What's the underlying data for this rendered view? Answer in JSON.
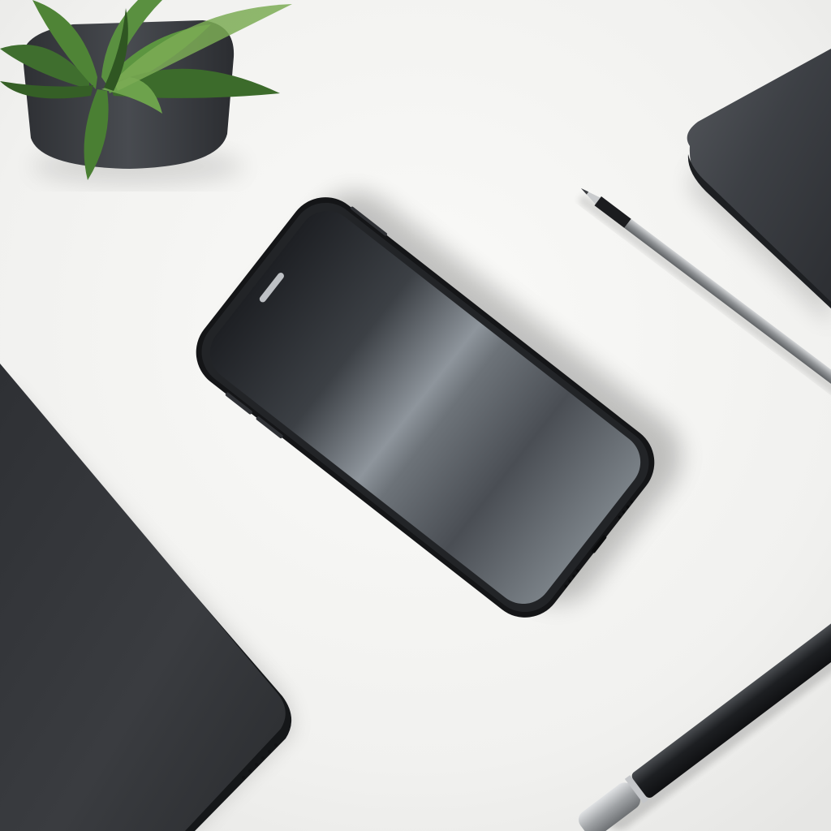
{
  "scene": {
    "objects": [
      "desk-surface",
      "potted-plant",
      "smartphone",
      "tablet",
      "notebook",
      "pencil",
      "pen"
    ]
  },
  "colors": {
    "desk": "#f3f3f1",
    "desk_shadow": "#e4e4e2",
    "device_black": "#2b2d30",
    "device_edge": "#15171a",
    "screen_dark": "#35383d",
    "screen_highlight": "#a4abb2",
    "plant_green": "#3f6e2e",
    "plant_light": "#7bab55",
    "pot": "#3a3d42",
    "notebook": "#3b3e43",
    "pencil_silver": "#a8abae",
    "pen_black": "#1d1f22"
  }
}
